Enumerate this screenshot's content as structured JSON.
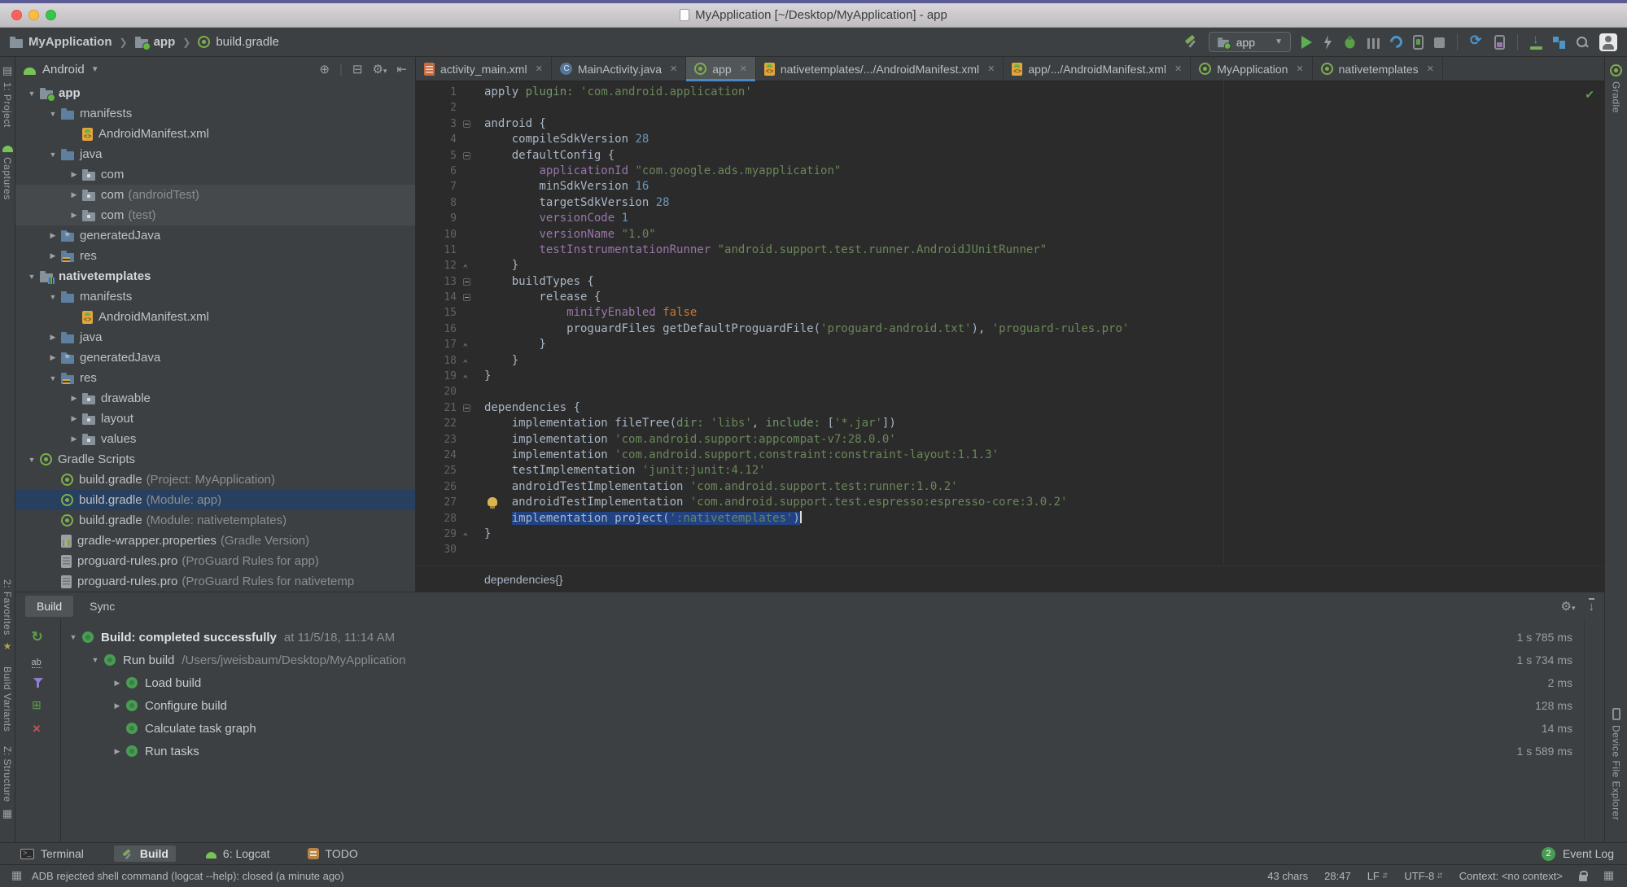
{
  "window": {
    "title": "MyApplication [~/Desktop/MyApplication] - app"
  },
  "navbar": {
    "breadcrumbs": [
      {
        "label": "MyApplication",
        "icon": "project-folder"
      },
      {
        "label": "app",
        "icon": "module-folder"
      },
      {
        "label": "build.gradle",
        "icon": "gradle"
      }
    ],
    "run_config": "app"
  },
  "left_stripe": {
    "top": [
      {
        "label": "1: Project",
        "icon": "project"
      },
      {
        "label": "Captures",
        "icon": "android"
      }
    ],
    "bottom": [
      {
        "label": "2: Favorites",
        "icon": "star"
      },
      {
        "label": "Build Variants",
        "icon": "none"
      },
      {
        "label": "Z: Structure",
        "icon": "grid"
      }
    ]
  },
  "right_stripe": {
    "top": [
      {
        "label": "Gradle",
        "icon": "gradle"
      }
    ],
    "bottom": [
      {
        "label": "Device File Explorer",
        "icon": "device"
      }
    ]
  },
  "project_panel": {
    "view": "Android",
    "tree": [
      {
        "i": 0,
        "a": "v",
        "ic": "module-app",
        "l": "app",
        "b": 1
      },
      {
        "i": 1,
        "a": "v",
        "ic": "folder",
        "l": "manifests"
      },
      {
        "i": 2,
        "a": "",
        "ic": "manifest",
        "l": "AndroidManifest.xml"
      },
      {
        "i": 1,
        "a": "v",
        "ic": "folder",
        "l": "java"
      },
      {
        "i": 2,
        "a": ">",
        "ic": "package",
        "l": "com"
      },
      {
        "i": 2,
        "a": ">",
        "ic": "package",
        "l": "com",
        "sfx": " (androidTest)",
        "shade": 1
      },
      {
        "i": 2,
        "a": ">",
        "ic": "package",
        "l": "com",
        "sfx": " (test)",
        "shade": 1
      },
      {
        "i": 1,
        "a": ">",
        "ic": "folder-gen",
        "l": "generatedJava"
      },
      {
        "i": 1,
        "a": ">",
        "ic": "folder-res",
        "l": "res"
      },
      {
        "i": 0,
        "a": "v",
        "ic": "module-lib",
        "l": "nativetemplates",
        "b": 1
      },
      {
        "i": 1,
        "a": "v",
        "ic": "folder",
        "l": "manifests"
      },
      {
        "i": 2,
        "a": "",
        "ic": "manifest",
        "l": "AndroidManifest.xml"
      },
      {
        "i": 1,
        "a": ">",
        "ic": "folder",
        "l": "java"
      },
      {
        "i": 1,
        "a": ">",
        "ic": "folder-gen",
        "l": "generatedJava"
      },
      {
        "i": 1,
        "a": "v",
        "ic": "folder-res",
        "l": "res"
      },
      {
        "i": 2,
        "a": ">",
        "ic": "package",
        "l": "drawable"
      },
      {
        "i": 2,
        "a": ">",
        "ic": "package",
        "l": "layout"
      },
      {
        "i": 2,
        "a": ">",
        "ic": "package",
        "l": "values"
      },
      {
        "i": 0,
        "a": "v",
        "ic": "gradle",
        "l": "Gradle Scripts"
      },
      {
        "i": 1,
        "a": "",
        "ic": "gradle",
        "l": "build.gradle",
        "sfx": " (Project: MyApplication)"
      },
      {
        "i": 1,
        "a": "",
        "ic": "gradle",
        "l": "build.gradle",
        "sfx": " (Module: app)",
        "sel": 1
      },
      {
        "i": 1,
        "a": "",
        "ic": "gradle",
        "l": "build.gradle",
        "sfx": " (Module: nativetemplates)"
      },
      {
        "i": 1,
        "a": "",
        "ic": "props",
        "l": "gradle-wrapper.properties",
        "sfx": " (Gradle Version)"
      },
      {
        "i": 1,
        "a": "",
        "ic": "pro",
        "l": "proguard-rules.pro",
        "sfx": " (ProGuard Rules for app)"
      },
      {
        "i": 1,
        "a": "",
        "ic": "pro",
        "l": "proguard-rules.pro",
        "sfx": " (ProGuard Rules for nativetemp"
      }
    ]
  },
  "editor": {
    "tabs": [
      {
        "label": "activity_main.xml",
        "icon": "xml-file"
      },
      {
        "label": "MainActivity.java",
        "icon": "java-class"
      },
      {
        "label": "app",
        "icon": "gradle",
        "sel": 1
      },
      {
        "label": "nativetemplates/.../AndroidManifest.xml",
        "icon": "manifest"
      },
      {
        "label": "app/.../AndroidManifest.xml",
        "icon": "manifest"
      },
      {
        "label": "MyApplication",
        "icon": "gradle"
      },
      {
        "label": "nativetemplates",
        "icon": "gradle"
      }
    ],
    "breadcrumbs": "dependencies{}",
    "lines": [
      {
        "n": 1,
        "s": [
          [
            "apply ",
            "d"
          ],
          [
            "plugin:",
            "m"
          ],
          [
            " ",
            "d"
          ],
          [
            "'com.android.application'",
            "s"
          ]
        ]
      },
      {
        "n": 2,
        "s": []
      },
      {
        "n": 3,
        "f": "o",
        "s": [
          [
            "android {",
            "d"
          ]
        ]
      },
      {
        "n": 4,
        "s": [
          [
            "    compileSdkVersion ",
            "d"
          ],
          [
            "28",
            "n"
          ]
        ]
      },
      {
        "n": 5,
        "f": "o",
        "s": [
          [
            "    defaultConfig {",
            "d"
          ]
        ]
      },
      {
        "n": 6,
        "s": [
          [
            "        ",
            "d"
          ],
          [
            "applicationId",
            "p"
          ],
          [
            " ",
            "d"
          ],
          [
            "\"com.google.ads.myapplication\"",
            "s"
          ]
        ]
      },
      {
        "n": 7,
        "s": [
          [
            "        minSdkVersion ",
            "d"
          ],
          [
            "16",
            "n"
          ]
        ]
      },
      {
        "n": 8,
        "s": [
          [
            "        targetSdkVersion ",
            "d"
          ],
          [
            "28",
            "n"
          ]
        ]
      },
      {
        "n": 9,
        "s": [
          [
            "        ",
            "d"
          ],
          [
            "versionCode",
            "p"
          ],
          [
            " ",
            "d"
          ],
          [
            "1",
            "n"
          ]
        ]
      },
      {
        "n": 10,
        "s": [
          [
            "        ",
            "d"
          ],
          [
            "versionName",
            "p"
          ],
          [
            " ",
            "d"
          ],
          [
            "\"1.0\"",
            "s"
          ]
        ]
      },
      {
        "n": 11,
        "s": [
          [
            "        ",
            "d"
          ],
          [
            "testInstrumentationRunner",
            "p"
          ],
          [
            " ",
            "d"
          ],
          [
            "\"android.support.test.runner.AndroidJUnitRunner\"",
            "s"
          ]
        ]
      },
      {
        "n": 12,
        "f": "c",
        "s": [
          [
            "    }",
            "d"
          ]
        ]
      },
      {
        "n": 13,
        "f": "o",
        "s": [
          [
            "    buildTypes {",
            "d"
          ]
        ]
      },
      {
        "n": 14,
        "f": "o",
        "s": [
          [
            "        release {",
            "d"
          ]
        ]
      },
      {
        "n": 15,
        "s": [
          [
            "            ",
            "d"
          ],
          [
            "minifyEnabled",
            "p"
          ],
          [
            " ",
            "d"
          ],
          [
            "false",
            "k"
          ]
        ]
      },
      {
        "n": 16,
        "s": [
          [
            "            proguardFiles getDefaultProguardFile(",
            "d"
          ],
          [
            "'proguard-android.txt'",
            "s"
          ],
          [
            "), ",
            "d"
          ],
          [
            "'proguard-rules.pro'",
            "s"
          ]
        ]
      },
      {
        "n": 17,
        "f": "c",
        "s": [
          [
            "        }",
            "d"
          ]
        ]
      },
      {
        "n": 18,
        "f": "c",
        "s": [
          [
            "    }",
            "d"
          ]
        ]
      },
      {
        "n": 19,
        "f": "c",
        "s": [
          [
            "}",
            "d"
          ]
        ]
      },
      {
        "n": 20,
        "s": []
      },
      {
        "n": 21,
        "f": "o",
        "s": [
          [
            "dependencies {",
            "d"
          ]
        ]
      },
      {
        "n": 22,
        "s": [
          [
            "    implementation fileTree(",
            "d"
          ],
          [
            "dir:",
            "m"
          ],
          [
            " ",
            "d"
          ],
          [
            "'libs'",
            "s"
          ],
          [
            ", ",
            "d"
          ],
          [
            "include:",
            "m"
          ],
          [
            " [",
            "d"
          ],
          [
            "'*.jar'",
            "s"
          ],
          [
            "])",
            "d"
          ]
        ]
      },
      {
        "n": 23,
        "s": [
          [
            "    implementation ",
            "d"
          ],
          [
            "'com.android.support:appcompat-v7:28.0.0'",
            "s"
          ]
        ]
      },
      {
        "n": 24,
        "s": [
          [
            "    implementation ",
            "d"
          ],
          [
            "'com.android.support.constraint:constraint-layout:1.1.3'",
            "s"
          ]
        ]
      },
      {
        "n": 25,
        "s": [
          [
            "    testImplementation ",
            "d"
          ],
          [
            "'junit:junit:4.12'",
            "s"
          ]
        ]
      },
      {
        "n": 26,
        "s": [
          [
            "    androidTestImplementation ",
            "d"
          ],
          [
            "'com.android.support.test:runner:1.0.2'",
            "s"
          ]
        ]
      },
      {
        "n": 27,
        "bulb": 1,
        "s": [
          [
            "    androidTestImplementation ",
            "d"
          ],
          [
            "'com.android.support.test.espresso:espresso-core:3.0.2'",
            "s"
          ]
        ]
      },
      {
        "n": 28,
        "caret": 1,
        "s": [
          [
            "    ",
            "d"
          ],
          [
            "implementation project(",
            "d",
            1
          ],
          [
            "':nativetemplates'",
            "s",
            1
          ],
          [
            ")",
            "d",
            1
          ]
        ]
      },
      {
        "n": 29,
        "f": "c",
        "s": [
          [
            "}",
            "d"
          ]
        ]
      },
      {
        "n": 30,
        "s": []
      }
    ]
  },
  "build_panel": {
    "tabs": [
      {
        "label": "Build",
        "sel": 1
      },
      {
        "label": "Sync"
      }
    ],
    "rows": [
      {
        "i": 0,
        "a": "v",
        "l": "Build: completed successfully",
        "b": 1,
        "det": "at 11/5/18, 11:14 AM",
        "t": "1 s 785 ms"
      },
      {
        "i": 1,
        "a": "v",
        "l": "Run build",
        "det": "/Users/jweisbaum/Desktop/MyApplication",
        "t": "1 s 734 ms"
      },
      {
        "i": 2,
        "a": ">",
        "l": "Load build",
        "t": "2 ms"
      },
      {
        "i": 2,
        "a": ">",
        "l": "Configure build",
        "t": "128 ms"
      },
      {
        "i": 2,
        "a": "",
        "l": "Calculate task graph",
        "t": "14 ms"
      },
      {
        "i": 2,
        "a": ">",
        "l": "Run tasks",
        "t": "1 s 589 ms"
      }
    ]
  },
  "toolwindow_bar": {
    "tabs": [
      {
        "label": "Terminal",
        "icon": "terminal"
      },
      {
        "label": "Build",
        "icon": "hammer",
        "sel": 1
      },
      {
        "label": "6: Logcat",
        "icon": "logcat"
      },
      {
        "label": "TODO",
        "icon": "todo"
      }
    ],
    "event_log": {
      "badge": "2",
      "label": "Event Log"
    }
  },
  "status_bar": {
    "message": "ADB rejected shell command (logcat --help): closed (a minute ago)",
    "items": [
      {
        "t": "43 chars"
      },
      {
        "t": "28:47"
      },
      {
        "t": "LF",
        "arrows": 1
      },
      {
        "t": "UTF-8",
        "arrows": 1
      },
      {
        "t": "Context: <no context>"
      }
    ]
  },
  "colors": {
    "selection_blue": "#214283",
    "tree_selection": "#27405f",
    "tab_underline": "#4a88c7",
    "string_green": "#6a8759",
    "number_blue": "#6897bb",
    "keyword_orange": "#cc7832",
    "property_purple": "#9876aa",
    "editor_bg": "#2b2b2b",
    "panel_bg": "#3d4043"
  }
}
